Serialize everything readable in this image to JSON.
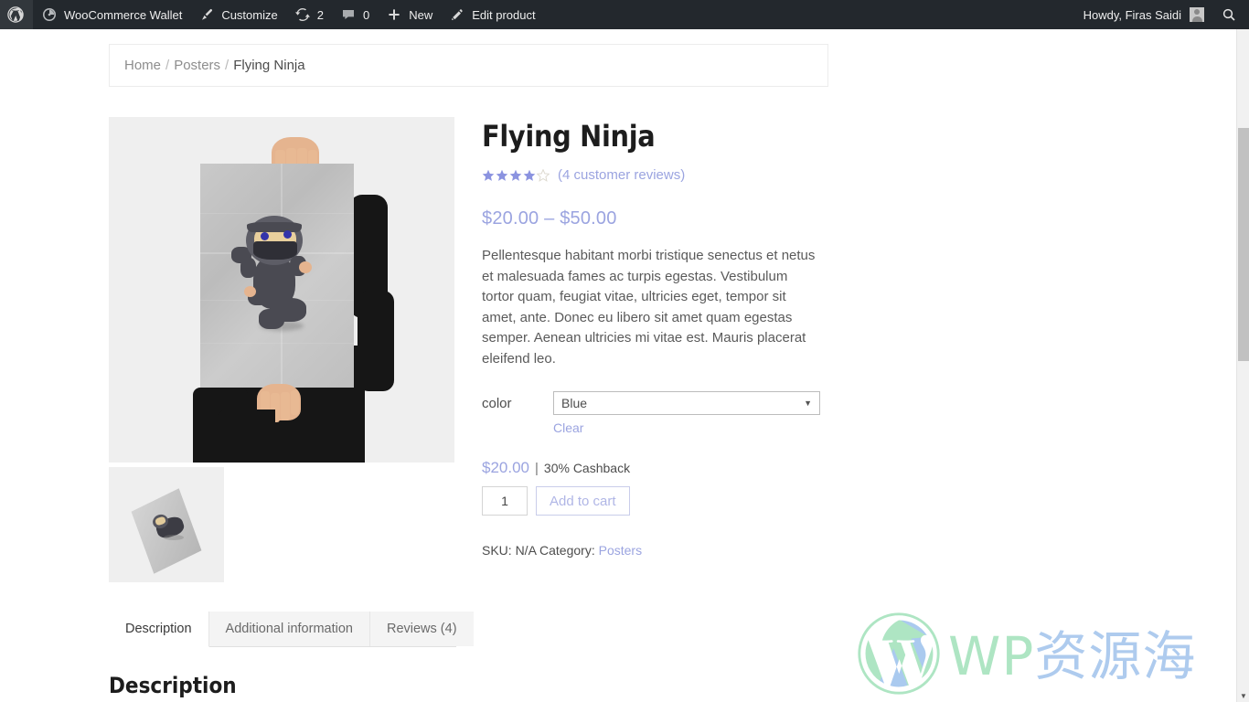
{
  "adminbar": {
    "logo_icon": "wordpress-logo-icon",
    "items": [
      {
        "id": "woocommerce-wallet",
        "label": "WooCommerce Wallet",
        "icon": "gauge-icon"
      },
      {
        "id": "customize",
        "label": "Customize",
        "icon": "paintbrush-icon"
      },
      {
        "id": "updates",
        "label": "2",
        "icon": "update-arrows-icon"
      },
      {
        "id": "comments",
        "label": "0",
        "icon": "comment-bubble-icon"
      },
      {
        "id": "new",
        "label": "New",
        "icon": "plus-icon"
      },
      {
        "id": "edit-product",
        "label": "Edit product",
        "icon": "pencil-icon"
      }
    ],
    "howdy": "Howdy, Firas Saidi",
    "avatar_icon": "user-avatar-icon",
    "search_icon": "search-icon"
  },
  "breadcrumb": {
    "home": "Home",
    "sep1": "/",
    "category": "Posters",
    "sep2": "/",
    "current": "Flying Ninja"
  },
  "product": {
    "title": "Flying Ninja",
    "rating_value": 4,
    "rating_max": 5,
    "reviews_link": "(4 customer reviews)",
    "price_range": "$20.00 – $50.00",
    "short_description": "Pellentesque habitant morbi tristique senectus et netus et malesuada fames ac turpis egestas. Vestibulum tortor quam, feugiat vitae, ultricies eget, tempor sit amet, ante. Donec eu libero sit amet quam egestas semper. Aenean ultricies mi vitae est. Mauris placerat eleifend leo.",
    "variation": {
      "label": "color",
      "selected": "Blue",
      "caret_icon": "chevron-down-icon",
      "clear_label": "Clear"
    },
    "variation_price": "$20.00",
    "pipe": "|",
    "cashback": "30% Cashback",
    "quantity": "1",
    "add_to_cart": "Add to cart",
    "meta_sku": "SKU: N/A Category:",
    "meta_category": "Posters",
    "gallery": {
      "main_alt": "poster-of-flying-ninja-held-by-person",
      "thumb_alt": "flying-ninja-poster-thumbnail"
    }
  },
  "tabs": [
    {
      "id": "description",
      "label": "Description",
      "active": true
    },
    {
      "id": "additional-information",
      "label": "Additional information",
      "active": false
    },
    {
      "id": "reviews",
      "label": "Reviews (4)",
      "active": false
    }
  ],
  "tab_content": {
    "heading": "Description"
  },
  "watermark": {
    "wp": "WP",
    "cn": "资源海",
    "logo_icon": "wordpress-logo-icon"
  },
  "scrollbar": {
    "down_arrow_icon": "chevron-down-icon",
    "up_arrow_icon": "chevron-up-icon"
  },
  "colors": {
    "adminbar_bg": "#23282d",
    "accent_periwinkle": "#9ba4e0",
    "star_fill": "#8b93e0",
    "star_empty": "#e2e0d8",
    "text": "#4d4d4d"
  }
}
